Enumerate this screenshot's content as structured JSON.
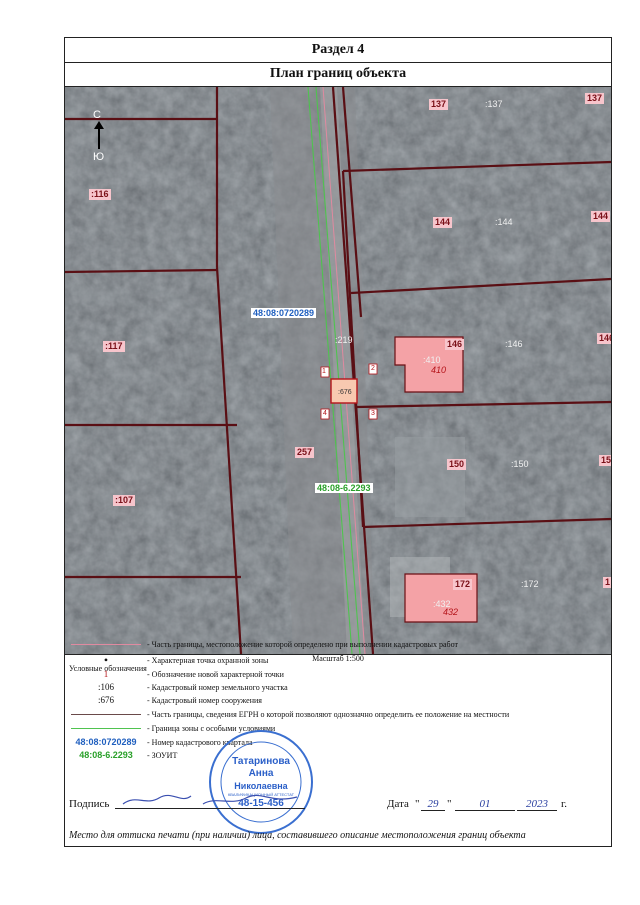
{
  "section_title": "Раздел 4",
  "plan_title": "План границ объекта",
  "map": {
    "compass_n": "С",
    "compass_s": "Ю",
    "parcels": [
      {
        "id": "p137a",
        "label": "137"
      },
      {
        "id": "p137b",
        "label": ":137"
      },
      {
        "id": "p137c",
        "label": "137"
      },
      {
        "id": "p116",
        "label": ":116"
      },
      {
        "id": "p144a",
        "label": "144"
      },
      {
        "id": "p144b",
        "label": ":144"
      },
      {
        "id": "p144c",
        "label": "144"
      },
      {
        "id": "p117",
        "label": ":117"
      },
      {
        "id": "p146a",
        "label": "146"
      },
      {
        "id": "p146b",
        "label": ":146"
      },
      {
        "id": "p146c",
        "label": "146"
      },
      {
        "id": "p410a",
        "label": ":410"
      },
      {
        "id": "p410b",
        "label": "410"
      },
      {
        "id": "p219",
        "label": ":219"
      },
      {
        "id": "p257",
        "label": "257"
      },
      {
        "id": "p150a",
        "label": "150"
      },
      {
        "id": "p150b",
        "label": ":150"
      },
      {
        "id": "p150c",
        "label": "15"
      },
      {
        "id": "p107",
        "label": ":107"
      },
      {
        "id": "p172a",
        "label": "172"
      },
      {
        "id": "p172b",
        "label": ":172"
      },
      {
        "id": "p172c",
        "label": "1"
      },
      {
        "id": "p432a",
        "label": ":432"
      },
      {
        "id": "p432b",
        "label": "432"
      },
      {
        "id": "p676",
        "label": ":676"
      }
    ],
    "points": [
      "1",
      "2",
      "3",
      "4"
    ],
    "quarter_label": "48:08:0720289",
    "zone_label": "48:08-6.2293"
  },
  "scale": "Масштаб 1:500",
  "legend": {
    "title": "Условные обозначения",
    "items": [
      {
        "symbol": "",
        "text": "- Часть границы, местоположение которой определено при выполнении кадастровых работ"
      },
      {
        "symbol": "•",
        "text": "- Характерная точка охранной зоны"
      },
      {
        "symbol": "1",
        "text": "- Обозначение новой характерной точки"
      },
      {
        "symbol": ":106",
        "text": "- Кадастровый номер земельного участка"
      },
      {
        "symbol": ":676",
        "text": "- Кадастровый номер сооружения"
      },
      {
        "symbol": "",
        "text": "- Часть границы, сведения ЕГРН о которой позволяют однозначно определить ее положение на местности"
      },
      {
        "symbol": "",
        "text": "- Граница зоны с особыми условиями"
      },
      {
        "symbol": "48:08:0720289",
        "text": "- Номер кадастрового квартала"
      },
      {
        "symbol": "48:08-6.2293",
        "text": "- ЗОУИТ"
      }
    ]
  },
  "signature": {
    "label": "Подпись",
    "date_label": "Дата",
    "day": "29",
    "month": "01",
    "year": "2023",
    "year_suffix": "г."
  },
  "stamp": {
    "name1": "Татаринова",
    "name2": "Анна",
    "name3": "Николаевна",
    "role": "КВАЛИФИКАЦИОННЫЙ АТТЕСТАТ",
    "number": "48-15-456"
  },
  "footer": "Место для оттиска печати (при наличии) лица, составившего описание местоположения границ объекта"
}
